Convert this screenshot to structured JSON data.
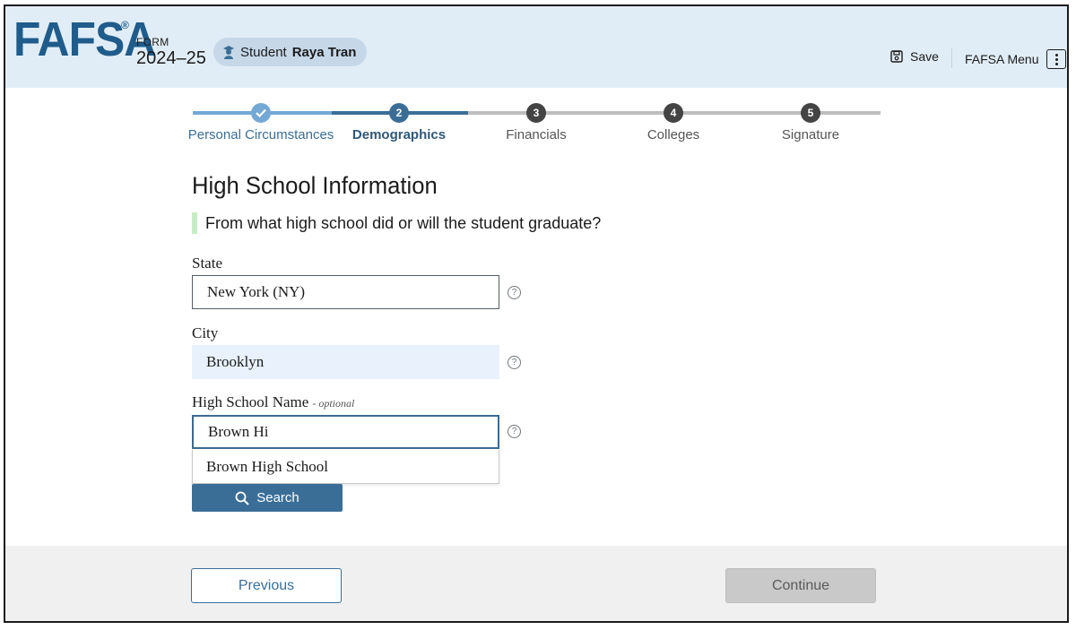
{
  "header": {
    "logo": "FAFSA",
    "logo_mark": "®",
    "form_label": "FORM",
    "form_year": "2024–25",
    "student_role": "Student",
    "student_name": "Raya Tran",
    "save_label": "Save",
    "menu_label": "FAFSA Menu"
  },
  "stepper": {
    "steps": [
      {
        "number": "",
        "label": "Personal Circumstances",
        "status": "complete"
      },
      {
        "number": "2",
        "label": "Demographics",
        "status": "current"
      },
      {
        "number": "3",
        "label": "Financials",
        "status": "upcoming"
      },
      {
        "number": "4",
        "label": "Colleges",
        "status": "upcoming"
      },
      {
        "number": "5",
        "label": "Signature",
        "status": "upcoming"
      }
    ]
  },
  "page": {
    "title": "High School Information",
    "question": "From what high school did or will the student graduate?"
  },
  "fields": {
    "state": {
      "label": "State",
      "value": "New York (NY)"
    },
    "city": {
      "label": "City",
      "value": "Brooklyn"
    },
    "school": {
      "label": "High School Name",
      "optional": "- optional",
      "value": "Brown Hi"
    },
    "help_symbol": "?"
  },
  "suggestion": "Brown High School",
  "search_label": "Search",
  "footer": {
    "previous_label": "Previous",
    "continue_label": "Continue"
  },
  "colors": {
    "brand": "#1f5c8b",
    "header_bg": "#e1edf6",
    "step_active": "#3b6e97",
    "step_upcoming": "#444444",
    "track_done": "#73a8d4",
    "track_todo": "#bdbdbd"
  },
  "icons": {
    "student": "student-icon",
    "save": "save-icon",
    "menu": "kebab-menu-icon",
    "complete": "check-icon",
    "search": "search-icon",
    "help": "help-icon"
  }
}
